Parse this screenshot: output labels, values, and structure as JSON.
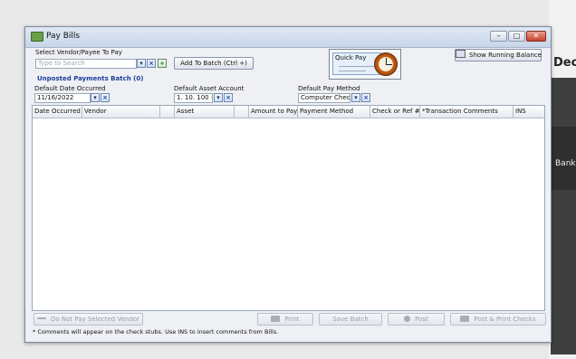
{
  "background": {
    "heading_partial": "Dec",
    "side_label_partial": "Bank"
  },
  "window": {
    "title": "Pay Bills",
    "controls": {
      "minimize": "–",
      "maximize": "□",
      "close": "✕"
    }
  },
  "vendor": {
    "label": "Select Vendor/Payee To Pay",
    "placeholder": "Type to Search",
    "add_to_batch": "Add To Batch (Ctrl +)"
  },
  "quick_pay": {
    "label": "Quick Pay"
  },
  "show_running_balance": "Show Running Balance",
  "batch": {
    "title": "Unposted Payments Batch (0)"
  },
  "defaults": {
    "date": {
      "label": "Default Date Occurred",
      "value": "11/16/2022"
    },
    "asset": {
      "label": "Default Asset Account",
      "value": "1. 10. 100 - H"
    },
    "method": {
      "label": "Default Pay Method",
      "value": "Computer Check"
    }
  },
  "table": {
    "columns": [
      "Date Occurred",
      "Vendor",
      "",
      "Asset",
      "",
      "Amount to Pay",
      "Payment Method",
      "Check or Ref #",
      "*Transaction Comments",
      "INS"
    ],
    "rows": []
  },
  "actions": {
    "do_not_pay": "Do Not Pay Selected Vendor",
    "print": "Print",
    "save_batch": "Save Batch",
    "post": "Post",
    "post_print": "Post & Print Checks"
  },
  "footer_note": "* Comments will appear on the check stubs. Use INS to insert comments from Bills.",
  "colors": {
    "accent": "#1e3f9a",
    "close": "#c8442c"
  }
}
